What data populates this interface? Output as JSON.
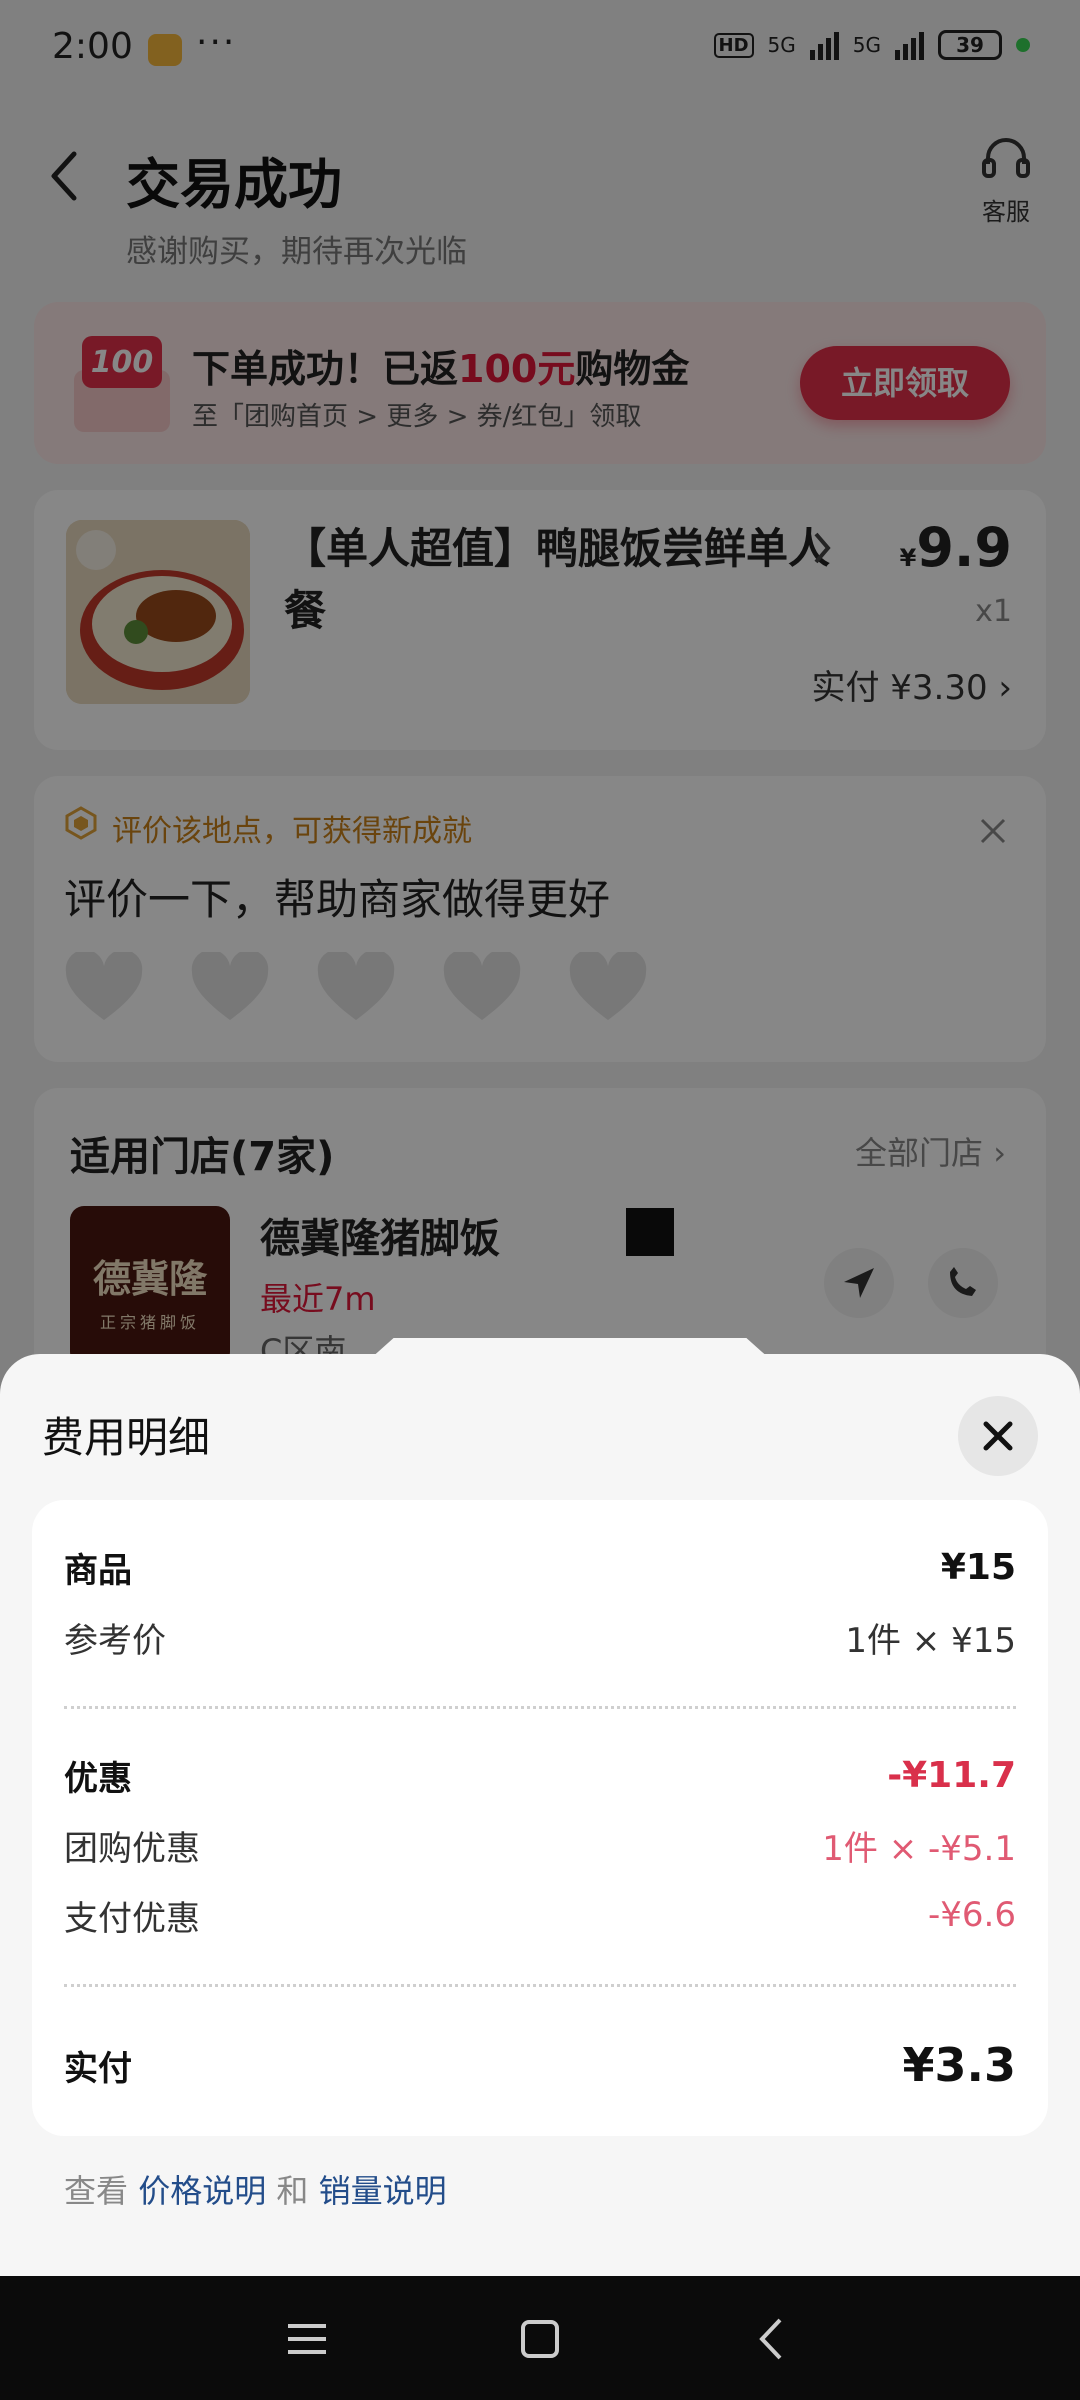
{
  "status_bar": {
    "time": "2:00",
    "dots": "···",
    "hd": "HD",
    "net1": "5G",
    "net2": "5G",
    "battery": "39"
  },
  "header": {
    "title": "交易成功",
    "subtitle": "感谢购买，期待再次光临",
    "service_label": "客服"
  },
  "promo": {
    "icon_text": "100",
    "title_prefix": "下单成功！已返",
    "title_highlight": "100元",
    "title_suffix": "购物金",
    "subtitle": "至「团购首页 > 更多 > 券/红包」领取",
    "button_label": "立即领取"
  },
  "product": {
    "title": "【单人超值】鸭腿饭尝鲜单人餐",
    "price_currency": "¥",
    "price": "9.9",
    "quantity": "x1",
    "paid": "实付 ¥3.30 ›"
  },
  "review": {
    "hint": "评价该地点，可获得新成就",
    "title": "评价一下，帮助商家做得更好",
    "rating_max": 5,
    "rating_value": 0
  },
  "stores": {
    "title": "适用门店(7家)",
    "all_label": "全部门店 ›",
    "store": {
      "logo_text": "德冀隆",
      "logo_subtext": "正宗猪脚饭",
      "name": "德冀隆猪脚饭",
      "distance": "最近7m",
      "address": "C区南"
    }
  },
  "sheet": {
    "title": "费用明细",
    "goods_label": "商品",
    "goods_value": "¥15",
    "ref_label": "参考价",
    "ref_value": "1件 × ¥15",
    "discount_label": "优惠",
    "discount_value": "-¥11.7",
    "group_label": "团购优惠",
    "group_value": "1件 × -¥5.1",
    "pay_label": "支付优惠",
    "pay_value": "-¥6.6",
    "total_label": "实付",
    "total_value": "¥3.3",
    "footer_prefix": "查看 ",
    "footer_link1": "价格说明",
    "footer_mid": " 和 ",
    "footer_link2": "销量说明"
  },
  "colors": {
    "accent_red": "#e2304a",
    "discount_red": "#d9304b",
    "link_blue": "#234d8a",
    "review_orange": "#c9801a"
  },
  "icons": [
    "back-icon",
    "headset-icon",
    "red-envelope-icon",
    "chevron-right-icon",
    "badge-icon",
    "close-icon",
    "heart-icon",
    "navigation-icon",
    "phone-icon",
    "menu-icon",
    "home-icon",
    "back-nav-icon"
  ]
}
